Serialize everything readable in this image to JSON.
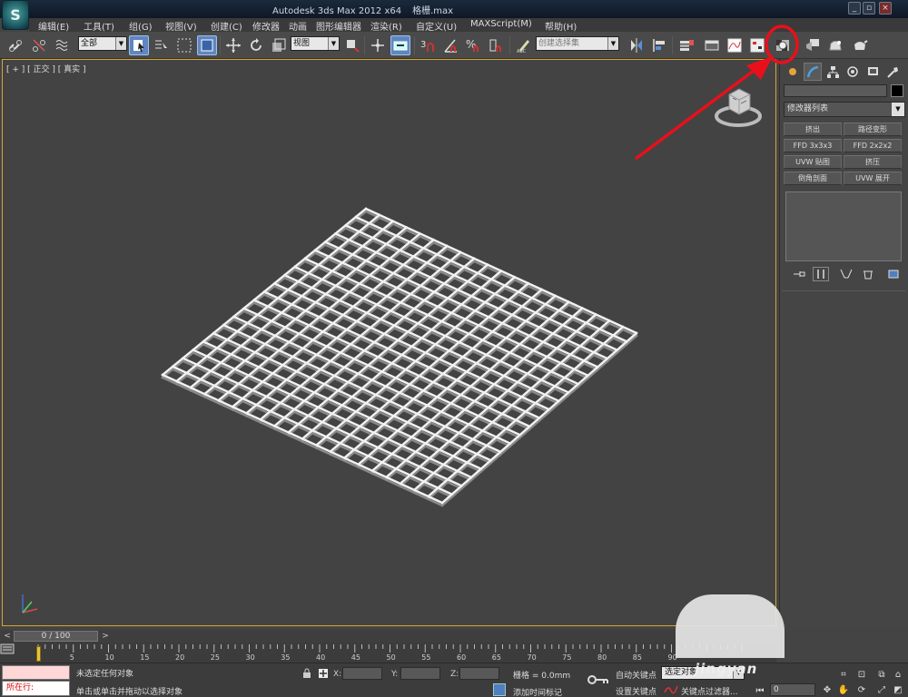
{
  "window": {
    "title": "Autodesk 3ds Max  2012 x64",
    "document": "格栅.max",
    "controls": [
      "_",
      "▫",
      "×"
    ]
  },
  "app_logo": "S",
  "menu": [
    "编辑(E)",
    "工具(T)",
    "组(G)",
    "视图(V)",
    "创建(C)",
    "修改器",
    "动画",
    "图形编辑器",
    "渲染(R)",
    "自定义(U)",
    "MAXScript(M)",
    "帮助(H)"
  ],
  "toolbar": {
    "selection_filter": "全部",
    "ref_coord": "视图",
    "named_selection": "创建选择集",
    "snap_3": "3",
    "percent_snap": "%",
    "highlighted_tool": "render-setup-button"
  },
  "viewport": {
    "label": "[ + ] [ 正交 ] [ 真实 ]",
    "grid_rows": 20,
    "grid_cols": 20
  },
  "command_panel": {
    "modifier_list": "修改器列表",
    "modifier_buttons": [
      "挤出",
      "路径变形",
      "FFD 3x3x3",
      "FFD 2x2x2",
      "UVW 贴图",
      "挤压",
      "倒角剖面",
      "UVW 展开"
    ],
    "object_color": "#000000"
  },
  "time_slider": {
    "position": "0 / 100",
    "prev": "<",
    "next": ">",
    "ticks": [
      5,
      10,
      15,
      20,
      25,
      30,
      35,
      40,
      45,
      50,
      55,
      60,
      65,
      70,
      75,
      80,
      85,
      90
    ]
  },
  "status": {
    "now_line": "所在行:",
    "selection": "未选定任何对象",
    "prompt": "单击或单击并拖动以选择对象",
    "x_label": "X:",
    "y_label": "Y:",
    "z_label": "Z:",
    "grid": "栅格 = 0.0mm",
    "add_time_tag": "添加时间标记",
    "auto_key": "自动关键点",
    "set_key": "设置关键点",
    "selection_set": "选定对象",
    "key_filters": "关键点过滤器...",
    "frame": "0"
  },
  "watermark": "jingyan",
  "colors": {
    "highlight_circle": "#e8101a",
    "arrow": "#e8101a",
    "viewport_border": "#d8a633",
    "active_tool": "#5f86c0",
    "grid_mesh": "#f2f2f2"
  }
}
